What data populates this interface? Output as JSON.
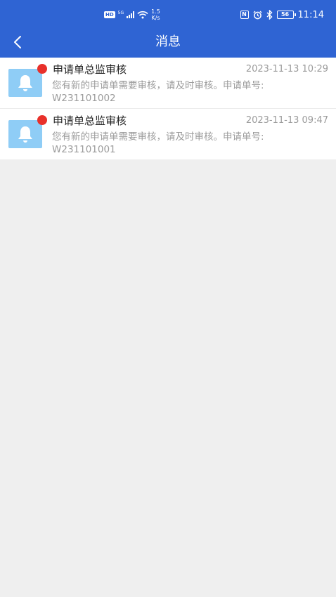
{
  "status_bar": {
    "hd": "HD",
    "signal": "5G",
    "speed_value": "1.5",
    "speed_unit": "K/s",
    "battery": "56",
    "time": "11:14"
  },
  "header": {
    "title": "消息",
    "back_icon": "chevron-left-icon"
  },
  "colors": {
    "header_bg": "#2f64d3",
    "unread_dot": "#e8302a",
    "bell_tile": "#8fcdf6"
  },
  "messages": [
    {
      "title": "申请单总监审核",
      "time": "2023-11-13 10:29",
      "body": "您有新的申请单需要审核，请及时审核。申请单号:",
      "order_no": "W231101002",
      "icon": "bell-icon",
      "unread": true
    },
    {
      "title": "申请单总监审核",
      "time": "2023-11-13 09:47",
      "body": "您有新的申请单需要审核，请及时审核。申请单号:",
      "order_no": "W231101001",
      "icon": "bell-icon",
      "unread": true
    }
  ]
}
